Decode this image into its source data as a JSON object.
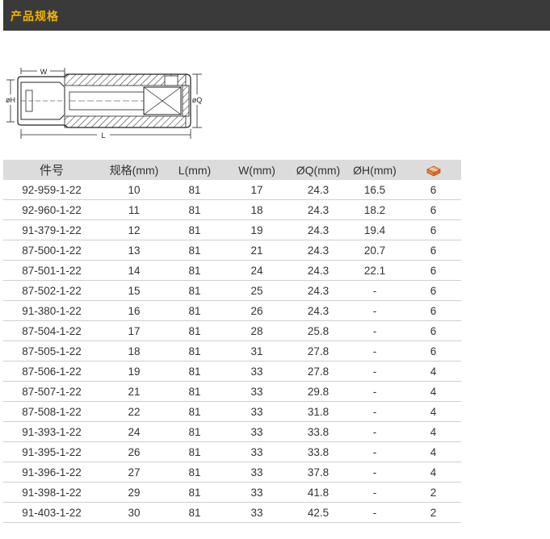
{
  "header": {
    "title": "产品规格"
  },
  "diagram": {
    "label_w": "W",
    "label_h": "øH",
    "label_q": "øQ",
    "label_l": "L"
  },
  "table": {
    "columns": [
      "件号",
      "规格(mm)",
      "L(mm)",
      "W(mm)",
      "ØQ(mm)",
      "ØH(mm)"
    ],
    "pack_icon": "box-icon",
    "rows": [
      [
        "92-959-1-22",
        "10",
        "81",
        "17",
        "24.3",
        "16.5",
        "6"
      ],
      [
        "92-960-1-22",
        "11",
        "81",
        "18",
        "24.3",
        "18.2",
        "6"
      ],
      [
        "91-379-1-22",
        "12",
        "81",
        "19",
        "24.3",
        "19.4",
        "6"
      ],
      [
        "87-500-1-22",
        "13",
        "81",
        "21",
        "24.3",
        "20.7",
        "6"
      ],
      [
        "87-501-1-22",
        "14",
        "81",
        "24",
        "24.3",
        "22.1",
        "6"
      ],
      [
        "87-502-1-22",
        "15",
        "81",
        "25",
        "24.3",
        "-",
        "6"
      ],
      [
        "91-380-1-22",
        "16",
        "81",
        "26",
        "24.3",
        "-",
        "6"
      ],
      [
        "87-504-1-22",
        "17",
        "81",
        "28",
        "25.8",
        "-",
        "6"
      ],
      [
        "87-505-1-22",
        "18",
        "81",
        "31",
        "27.8",
        "-",
        "6"
      ],
      [
        "87-506-1-22",
        "19",
        "81",
        "33",
        "27.8",
        "-",
        "4"
      ],
      [
        "87-507-1-22",
        "21",
        "81",
        "33",
        "29.8",
        "-",
        "4"
      ],
      [
        "87-508-1-22",
        "22",
        "81",
        "33",
        "31.8",
        "-",
        "4"
      ],
      [
        "91-393-1-22",
        "24",
        "81",
        "33",
        "33.8",
        "-",
        "4"
      ],
      [
        "91-395-1-22",
        "26",
        "81",
        "33",
        "33.8",
        "-",
        "4"
      ],
      [
        "91-396-1-22",
        "27",
        "81",
        "33",
        "37.8",
        "-",
        "4"
      ],
      [
        "91-398-1-22",
        "29",
        "81",
        "33",
        "41.8",
        "-",
        "2"
      ],
      [
        "91-403-1-22",
        "30",
        "81",
        "33",
        "42.5",
        "-",
        "2"
      ]
    ]
  }
}
